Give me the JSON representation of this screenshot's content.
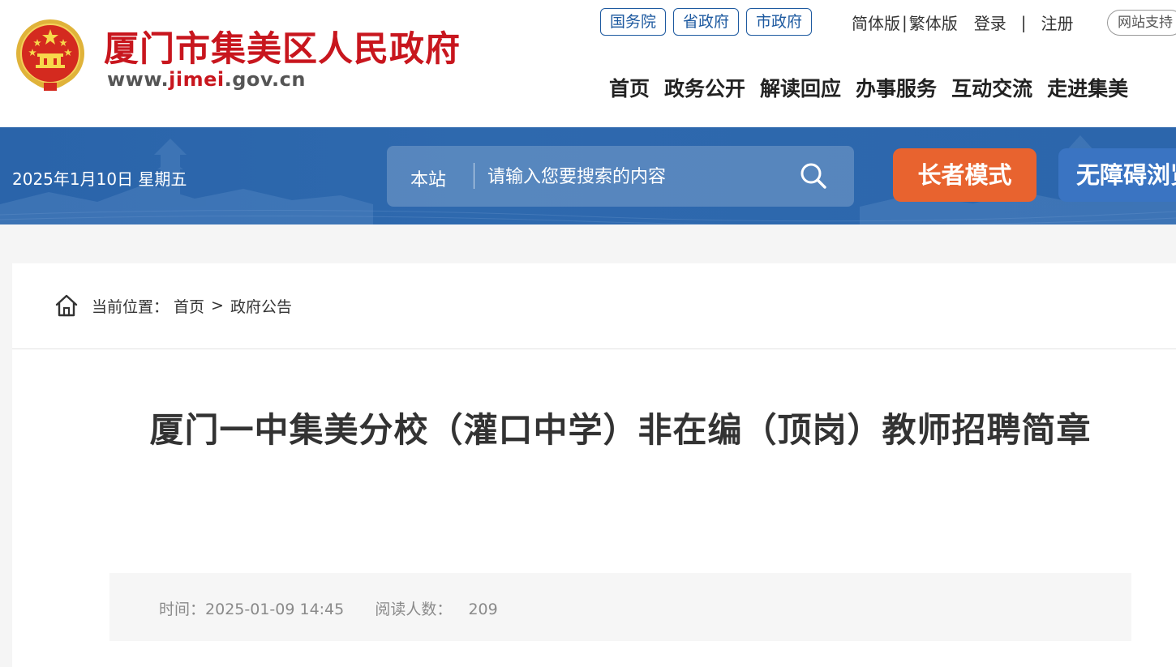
{
  "header": {
    "site_name": "厦门市集美区人民政府",
    "site_url_prefix": "www.",
    "site_url_highlight": "jimei",
    "site_url_suffix": ".gov.cn",
    "gov_links": [
      "国务院",
      "省政府",
      "市政府"
    ],
    "simplified_label": "简体版",
    "traditional_label": "繁体版",
    "login_label": "登录",
    "register_label": "注册",
    "support_label": "网站支持",
    "nav": [
      "首页",
      "政务公开",
      "解读回应",
      "办事服务",
      "互动交流",
      "走进集美"
    ]
  },
  "banner": {
    "date": "2025年1月10日 星期五",
    "search_scope": "本站",
    "search_placeholder": "请输入您要搜索的内容",
    "elder_mode_label": "长者模式",
    "accessibility_label": "无障碍浏览"
  },
  "breadcrumb": {
    "prefix": "当前位置：",
    "items": [
      "首页",
      "政府公告"
    ],
    "separator": ">"
  },
  "article": {
    "title": "厦门一中集美分校（灌口中学）非在编（顶岗）教师招聘简章",
    "time_label": "时间：",
    "time_value": "2025-01-09 14:45",
    "reads_label": "阅读人数：",
    "reads_value": "209"
  },
  "colors": {
    "brand_red": "#c8161e",
    "link_blue": "#1e5aa0",
    "banner_blue": "#2c66ac",
    "elder_orange": "#e8632f",
    "access_blue": "#3a74c2"
  },
  "icons": {
    "emblem": "national-emblem-icon",
    "search": "search-icon",
    "home": "home-icon"
  }
}
